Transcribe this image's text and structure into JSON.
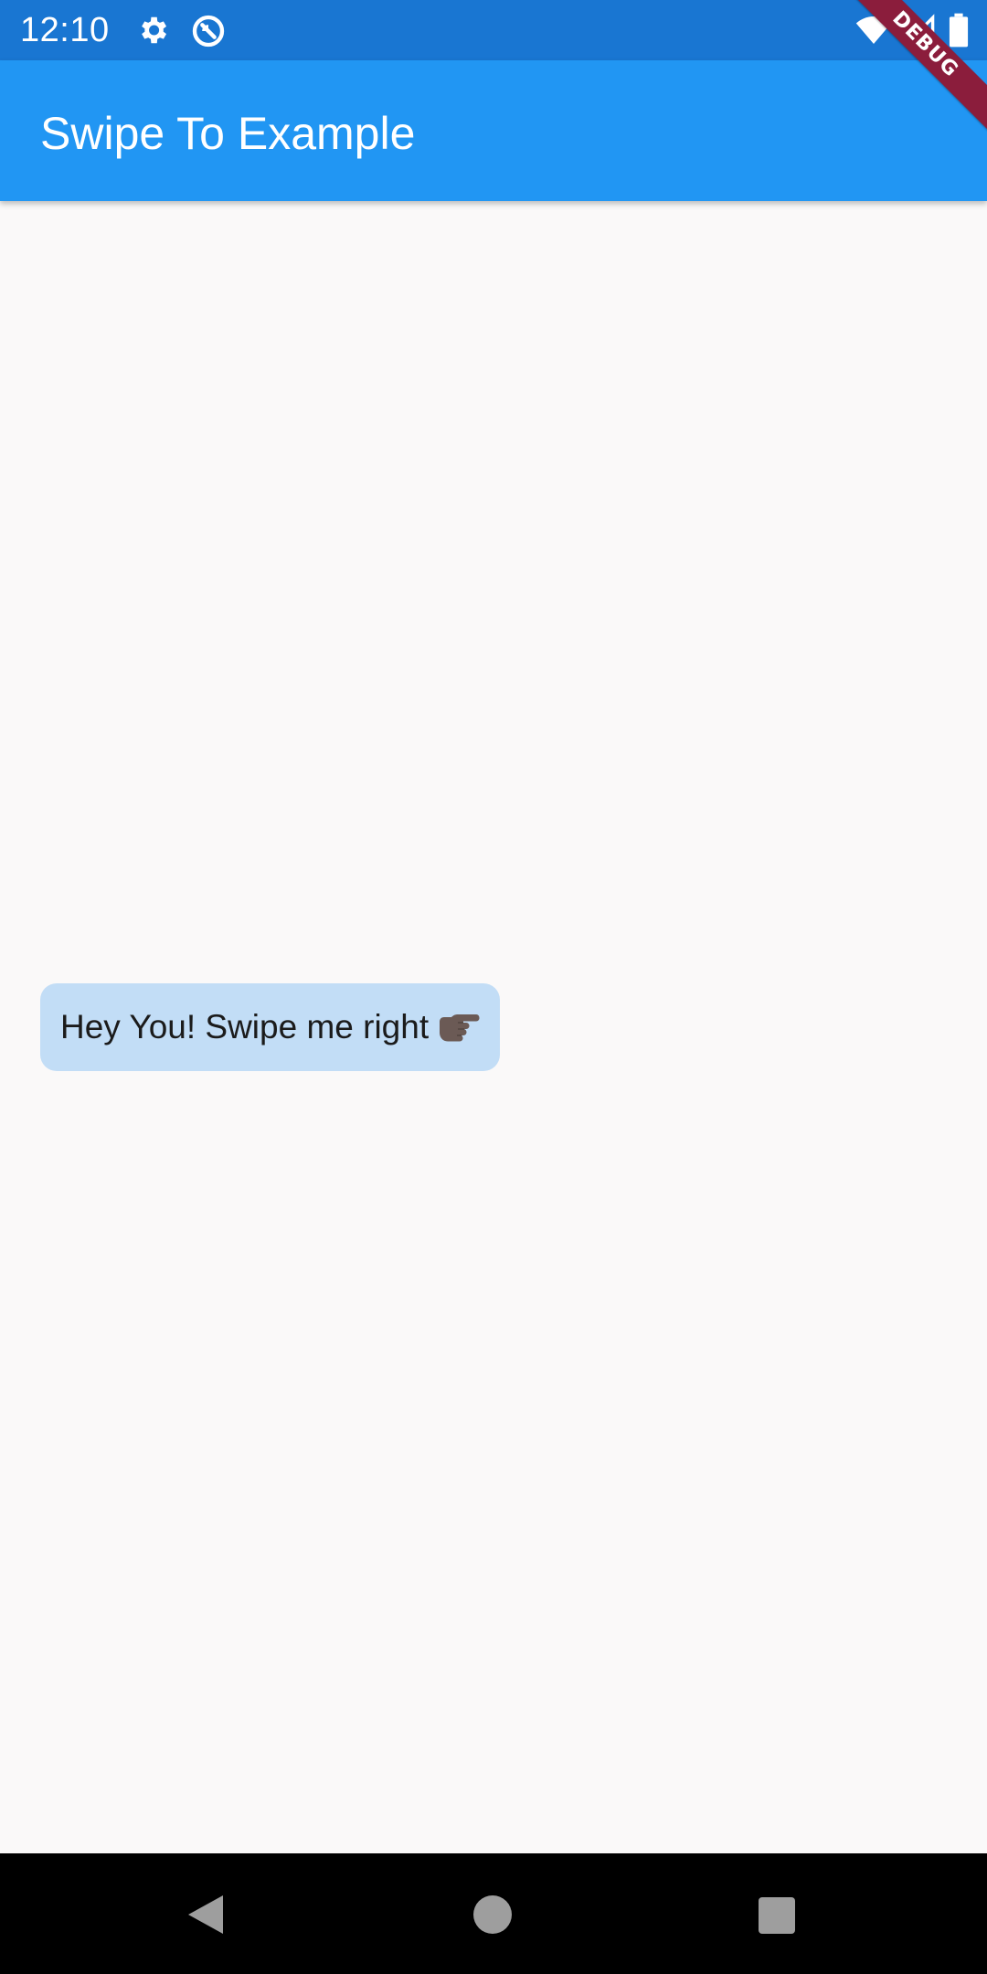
{
  "status_bar": {
    "time": "12:10",
    "icons": [
      "gear-icon",
      "sync-icon",
      "wifi-icon",
      "signal-icon",
      "battery-icon"
    ]
  },
  "debug_banner": {
    "label": "DEBUG"
  },
  "app_bar": {
    "title": "Swipe To Example",
    "color": "#2196f3"
  },
  "message": {
    "text": "Hey You! Swipe me right",
    "emoji_icon": "pointing-right-hand-icon",
    "bubble_color": "#c2ddf6"
  },
  "nav_bar": {
    "buttons": [
      "back-icon",
      "home-icon",
      "recents-icon"
    ]
  }
}
